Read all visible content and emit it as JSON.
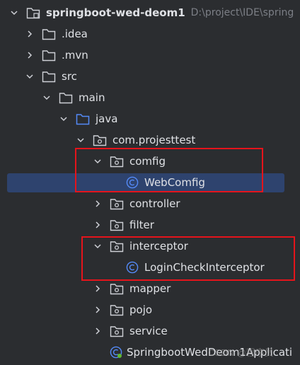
{
  "tree": {
    "root": {
      "label": "springboot-wed-deom1",
      "path": "D:\\project\\IDE\\spring"
    },
    "idea": ".idea",
    "mvn": ".mvn",
    "src": "src",
    "main": "main",
    "java": "java",
    "package": "com.projesttest",
    "comfig": "comfig",
    "webcomfig": "WebComfig",
    "controller": "controller",
    "filter": "filter",
    "interceptor": "interceptor",
    "logincheck": "LoginCheckInterceptor",
    "mapper": "mapper",
    "pojo": "pojo",
    "service": "service",
    "app": "SpringbootWedDeom1Applicati"
  },
  "watermark": "CSDN @程序员",
  "colors": {
    "background": "#2b2d30",
    "selection": "#2e436e",
    "highlight_box": "#e5141b",
    "class_icon": "#548af7"
  }
}
